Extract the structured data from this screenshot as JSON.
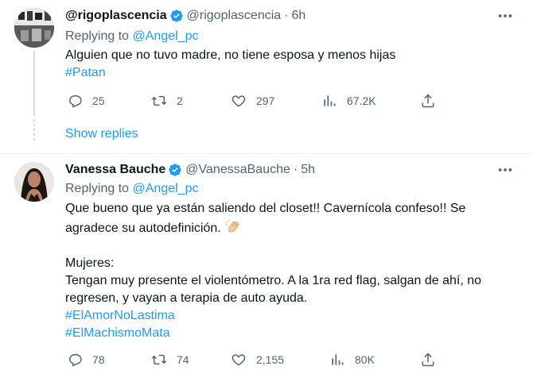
{
  "tweets": [
    {
      "display_name": "@rigoplascencia",
      "handle": "@rigoplascencia",
      "time": "6h",
      "replying_label": "Replying to",
      "replying_to": "@Angel_pc",
      "text_lines": [
        "Alguien que no tuvo madre, no tiene esposa y menos hijas"
      ],
      "hashtags": [
        "#Patan"
      ],
      "reply_count": "25",
      "retweet_count": "2",
      "like_count": "297",
      "view_count": "67.2K",
      "show_replies": "Show replies"
    },
    {
      "display_name": "Vanessa Bauche",
      "handle": "@VanessaBauche",
      "time": "5h",
      "replying_label": "Replying to",
      "replying_to": "@Angel_pc",
      "text_line1": "Que bueno que ya están saliendo del closet!! Cavernícola confeso!! Se",
      "text_line2": "agradece su autodefinición.",
      "text_line3": "Mujeres:",
      "text_line4": "Tengan muy presente el violentómetro. A la 1ra red flag, salgan de ahí, no",
      "text_line5": "regresen, y vayan a terapia de auto ayuda.",
      "hashtags": [
        "#ElAmorNoLastima",
        "#ElMachismoMata"
      ],
      "reply_count": "78",
      "retweet_count": "74",
      "like_count": "2,155",
      "view_count": "80K"
    }
  ],
  "colors": {
    "accent": "#1d9bf0",
    "secondary_text": "#536471",
    "primary_text": "#0f1419",
    "verified": "#1d9bf0"
  }
}
